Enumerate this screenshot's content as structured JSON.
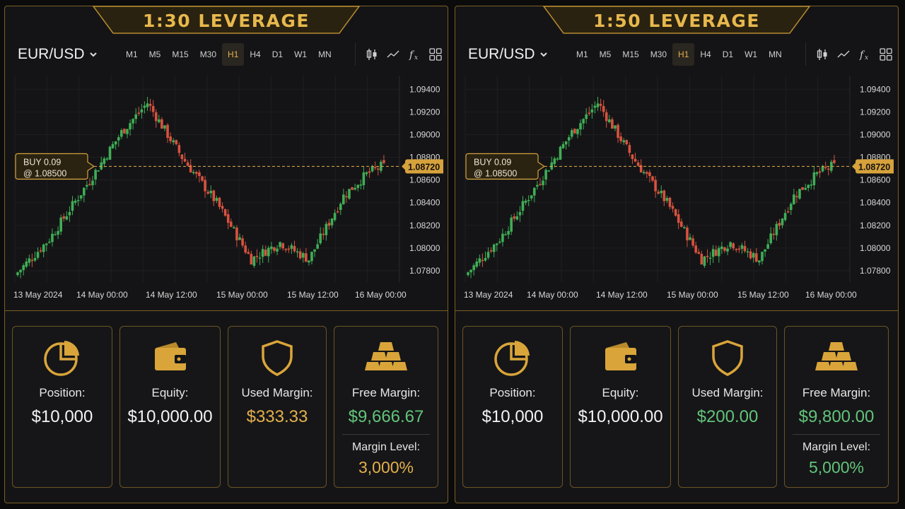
{
  "colors": {
    "gold": "#e3b04b",
    "green": "#62c47a",
    "red": "#e5533d",
    "bull": "#3fae56",
    "bear": "#d8523f"
  },
  "panels": [
    {
      "title": "1:30 LEVERAGE",
      "symbol": "EUR/USD",
      "timeframes": [
        "M1",
        "M5",
        "M15",
        "M30",
        "H1",
        "H4",
        "D1",
        "W1",
        "MN"
      ],
      "active_timeframe": "H1",
      "tools": [
        "candlestick-icon",
        "line-chart-icon",
        "fx-icon",
        "grid-icon"
      ],
      "chart_data": {
        "type": "candlestick",
        "price_labels": [
          "1.09400",
          "1.09200",
          "1.09000",
          "1.08800",
          "1.08600",
          "1.08400",
          "1.08200",
          "1.08000",
          "1.07800"
        ],
        "ylim": [
          1.077,
          1.0952
        ],
        "x_labels": [
          "13 May 2024",
          "14 May 00:00",
          "14 May 12:00",
          "15 May 00:00",
          "15 May 12:00",
          "16 May 00:00"
        ],
        "current_price": "1.08720",
        "current_price_value": 1.0872,
        "order_line": {
          "label1": "BUY 0.09",
          "label2": "@ 1.08500"
        }
      },
      "stats": {
        "position": {
          "label": "Position:",
          "value": "$10,000"
        },
        "equity": {
          "label": "Equity:",
          "value": "$10,000.00"
        },
        "used_margin": {
          "label": "Used Margin:",
          "value": "$333.33"
        },
        "free_margin": {
          "label": "Free Margin:",
          "value": "$9,666.67"
        },
        "margin_level": {
          "label": "Margin Level:",
          "value": "3,000%"
        }
      }
    },
    {
      "title": "1:50 LEVERAGE",
      "symbol": "EUR/USD",
      "timeframes": [
        "M1",
        "M5",
        "M15",
        "M30",
        "H1",
        "H4",
        "D1",
        "W1",
        "MN"
      ],
      "active_timeframe": "H1",
      "tools": [
        "candlestick-icon",
        "line-chart-icon",
        "fx-icon",
        "grid-icon"
      ],
      "chart_data": {
        "type": "candlestick",
        "price_labels": [
          "1.09400",
          "1.09200",
          "1.09000",
          "1.08800",
          "1.08600",
          "1.08400",
          "1.08200",
          "1.08000",
          "1.07800"
        ],
        "ylim": [
          1.077,
          1.0952
        ],
        "x_labels": [
          "13 May 2024",
          "14 May 00:00",
          "14 May 12:00",
          "15 May 00:00",
          "15 May 12:00",
          "16 May 00:00"
        ],
        "current_price": "1.08720",
        "current_price_value": 1.0872,
        "order_line": {
          "label1": "BUY 0.09",
          "label2": "@ 1.08500"
        }
      },
      "stats": {
        "position": {
          "label": "Position:",
          "value": "$10,000"
        },
        "equity": {
          "label": "Equity:",
          "value": "$10,000.00"
        },
        "used_margin": {
          "label": "Used Margin:",
          "value": "$200.00"
        },
        "free_margin": {
          "label": "Free Margin:",
          "value": "$9,800.00"
        },
        "margin_level": {
          "label": "Margin Level:",
          "value": "5,000%"
        }
      }
    }
  ]
}
